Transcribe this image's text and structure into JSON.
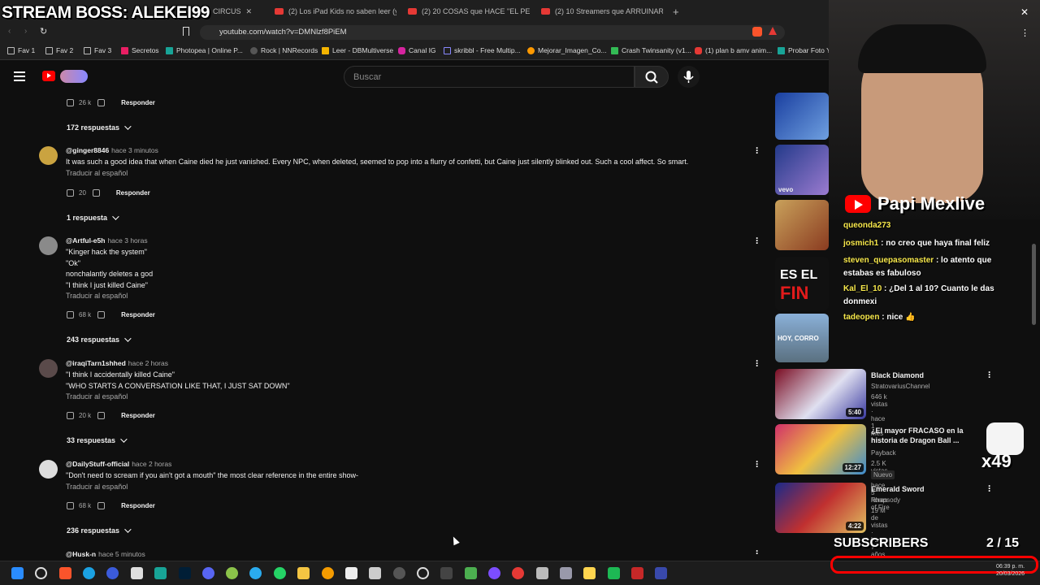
{
  "overlay": {
    "title": "STREAM BOSS: ALEKEI99",
    "channel": "Papi Mexlive",
    "subscribers_label": "SUBSCRIBERS",
    "sub_count": "2 / 15",
    "multiplier": "x49"
  },
  "tabs": [
    {
      "label": "CIRCUS"
    },
    {
      "label": "(2) Los iPad Kids no saben leer (y nad"
    },
    {
      "label": "(2) 20 COSAS que HACE \"EL PERSONA"
    },
    {
      "label": "(2) 10 Streamers que ARRUINARON"
    }
  ],
  "address": {
    "url": "youtube.com/watch?v=DMNlzf8PiEM"
  },
  "bookmarks": [
    "Fav 1",
    "Fav 2",
    "Fav 3",
    "Secretos",
    "Photopea | Online P...",
    "Rock | NNRecords",
    "Leer - DBMultiverse",
    "Canal IG",
    "skribbl - Free Multip...",
    "Mejorar_Imagen_Co...",
    "Crash Twinsanity (v1...",
    "(1) plan b amv anim...",
    "Probar Foto Y"
  ],
  "search": {
    "placeholder": "Buscar"
  },
  "top_actions": {
    "likes": "26 k",
    "reply": "Responder",
    "replies": "172 respuestas"
  },
  "comments": [
    {
      "author": "@ginger8846",
      "time": "hace 3 minutos",
      "lines": [
        "It was such a good idea that when Caine died he just vanished. Every NPC, when deleted, seemed to pop into a flurry of confetti, but Caine just silently blinked out. Such a cool affect. So smart."
      ],
      "translate": "Traducir al español",
      "likes": "20",
      "reply": "Responder",
      "replies": "1 respuesta"
    },
    {
      "author": "@Artful-e5h",
      "time": "hace 3 horas",
      "lines": [
        "\"Kinger hack the system\"",
        "\"Ok\"",
        "nonchalantly deletes a god",
        "\"I think I just killed Caine\""
      ],
      "translate": "Traducir al español",
      "likes": "68 k",
      "reply": "Responder",
      "replies": "243 respuestas"
    },
    {
      "author": "@iraqiTarn1shhed",
      "time": "hace 2 horas",
      "lines": [
        "\"I think I accidentally killed Caine\"",
        "\"WHO STARTS A CONVERSATION LIKE THAT, I JUST SAT DOWN\""
      ],
      "translate": "Traducir al español",
      "likes": "20 k",
      "reply": "Responder",
      "replies": "33 respuestas"
    },
    {
      "author": "@DailyStuff-official",
      "time": "hace 2 horas",
      "lines": [
        "\"Don't need to scream if you ain't got a mouth\" the most clear reference in the entire show-"
      ],
      "translate": "Traducir al español",
      "likes": "68 k",
      "reply": "Responder",
      "replies": "236 respuestas"
    },
    {
      "author": "@Husk-n",
      "time": "hace 5 minutos"
    }
  ],
  "sidebar": [
    {
      "title": "Black Diamond",
      "channel": "StratovariusChannel",
      "meta": "646 k vistas · hace 1 mes",
      "duration": "5:40"
    },
    {
      "title": "¿El mayor FRACASO en la historia de Dragon Ball ...",
      "channel": "Payback",
      "meta": "2.5 K vistas · hace 5 horas",
      "badge": "Nuevo",
      "duration": "12:27"
    },
    {
      "title": "Emerald Sword",
      "channel": "Rhapsody of Fire",
      "meta": "19 M de vistas · hace 7 años",
      "duration": "4:22"
    }
  ],
  "sidebar_top_labels": {
    "vevo": "vevo",
    "es_el": "ES EL",
    "fin": "FIN",
    "hoy": "HOY, CORRO"
  },
  "chat": [
    {
      "user": "queonda273",
      "msg": ""
    },
    {
      "user": "josmich1",
      "msg": ": no creo que haya final feliz"
    },
    {
      "user": "steven_quepasomaster",
      "msg": ": lo atento que estabas es fabuloso"
    },
    {
      "user": "Kal_El_10",
      "msg": ": ¿Del 1 al 10? Cuanto le das donmexi"
    },
    {
      "user": "tadeopen",
      "msg": ": nice 👍"
    }
  ],
  "clock": {
    "time": "06:39 p. m.",
    "date": "20/03/2026"
  },
  "colors": {
    "bg": "#0f0f0f",
    "accent": "#ff0000",
    "chat_user": "#f7e84b"
  }
}
